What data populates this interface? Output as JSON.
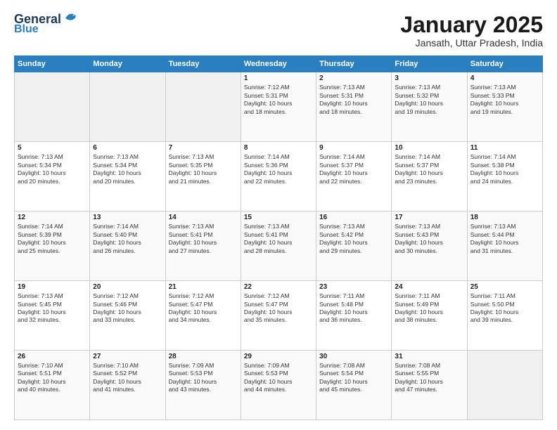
{
  "header": {
    "logo_line1": "General",
    "logo_line2": "Blue",
    "month_title": "January 2025",
    "location": "Jansath, Uttar Pradesh, India"
  },
  "weekdays": [
    "Sunday",
    "Monday",
    "Tuesday",
    "Wednesday",
    "Thursday",
    "Friday",
    "Saturday"
  ],
  "weeks": [
    [
      {
        "day": "",
        "text": ""
      },
      {
        "day": "",
        "text": ""
      },
      {
        "day": "",
        "text": ""
      },
      {
        "day": "1",
        "text": "Sunrise: 7:12 AM\nSunset: 5:31 PM\nDaylight: 10 hours\nand 18 minutes."
      },
      {
        "day": "2",
        "text": "Sunrise: 7:13 AM\nSunset: 5:31 PM\nDaylight: 10 hours\nand 18 minutes."
      },
      {
        "day": "3",
        "text": "Sunrise: 7:13 AM\nSunset: 5:32 PM\nDaylight: 10 hours\nand 19 minutes."
      },
      {
        "day": "4",
        "text": "Sunrise: 7:13 AM\nSunset: 5:33 PM\nDaylight: 10 hours\nand 19 minutes."
      }
    ],
    [
      {
        "day": "5",
        "text": "Sunrise: 7:13 AM\nSunset: 5:34 PM\nDaylight: 10 hours\nand 20 minutes."
      },
      {
        "day": "6",
        "text": "Sunrise: 7:13 AM\nSunset: 5:34 PM\nDaylight: 10 hours\nand 20 minutes."
      },
      {
        "day": "7",
        "text": "Sunrise: 7:13 AM\nSunset: 5:35 PM\nDaylight: 10 hours\nand 21 minutes."
      },
      {
        "day": "8",
        "text": "Sunrise: 7:14 AM\nSunset: 5:36 PM\nDaylight: 10 hours\nand 22 minutes."
      },
      {
        "day": "9",
        "text": "Sunrise: 7:14 AM\nSunset: 5:37 PM\nDaylight: 10 hours\nand 22 minutes."
      },
      {
        "day": "10",
        "text": "Sunrise: 7:14 AM\nSunset: 5:37 PM\nDaylight: 10 hours\nand 23 minutes."
      },
      {
        "day": "11",
        "text": "Sunrise: 7:14 AM\nSunset: 5:38 PM\nDaylight: 10 hours\nand 24 minutes."
      }
    ],
    [
      {
        "day": "12",
        "text": "Sunrise: 7:14 AM\nSunset: 5:39 PM\nDaylight: 10 hours\nand 25 minutes."
      },
      {
        "day": "13",
        "text": "Sunrise: 7:14 AM\nSunset: 5:40 PM\nDaylight: 10 hours\nand 26 minutes."
      },
      {
        "day": "14",
        "text": "Sunrise: 7:13 AM\nSunset: 5:41 PM\nDaylight: 10 hours\nand 27 minutes."
      },
      {
        "day": "15",
        "text": "Sunrise: 7:13 AM\nSunset: 5:41 PM\nDaylight: 10 hours\nand 28 minutes."
      },
      {
        "day": "16",
        "text": "Sunrise: 7:13 AM\nSunset: 5:42 PM\nDaylight: 10 hours\nand 29 minutes."
      },
      {
        "day": "17",
        "text": "Sunrise: 7:13 AM\nSunset: 5:43 PM\nDaylight: 10 hours\nand 30 minutes."
      },
      {
        "day": "18",
        "text": "Sunrise: 7:13 AM\nSunset: 5:44 PM\nDaylight: 10 hours\nand 31 minutes."
      }
    ],
    [
      {
        "day": "19",
        "text": "Sunrise: 7:13 AM\nSunset: 5:45 PM\nDaylight: 10 hours\nand 32 minutes."
      },
      {
        "day": "20",
        "text": "Sunrise: 7:12 AM\nSunset: 5:46 PM\nDaylight: 10 hours\nand 33 minutes."
      },
      {
        "day": "21",
        "text": "Sunrise: 7:12 AM\nSunset: 5:47 PM\nDaylight: 10 hours\nand 34 minutes."
      },
      {
        "day": "22",
        "text": "Sunrise: 7:12 AM\nSunset: 5:47 PM\nDaylight: 10 hours\nand 35 minutes."
      },
      {
        "day": "23",
        "text": "Sunrise: 7:11 AM\nSunset: 5:48 PM\nDaylight: 10 hours\nand 36 minutes."
      },
      {
        "day": "24",
        "text": "Sunrise: 7:11 AM\nSunset: 5:49 PM\nDaylight: 10 hours\nand 38 minutes."
      },
      {
        "day": "25",
        "text": "Sunrise: 7:11 AM\nSunset: 5:50 PM\nDaylight: 10 hours\nand 39 minutes."
      }
    ],
    [
      {
        "day": "26",
        "text": "Sunrise: 7:10 AM\nSunset: 5:51 PM\nDaylight: 10 hours\nand 40 minutes."
      },
      {
        "day": "27",
        "text": "Sunrise: 7:10 AM\nSunset: 5:52 PM\nDaylight: 10 hours\nand 41 minutes."
      },
      {
        "day": "28",
        "text": "Sunrise: 7:09 AM\nSunset: 5:53 PM\nDaylight: 10 hours\nand 43 minutes."
      },
      {
        "day": "29",
        "text": "Sunrise: 7:09 AM\nSunset: 5:53 PM\nDaylight: 10 hours\nand 44 minutes."
      },
      {
        "day": "30",
        "text": "Sunrise: 7:08 AM\nSunset: 5:54 PM\nDaylight: 10 hours\nand 45 minutes."
      },
      {
        "day": "31",
        "text": "Sunrise: 7:08 AM\nSunset: 5:55 PM\nDaylight: 10 hours\nand 47 minutes."
      },
      {
        "day": "",
        "text": ""
      }
    ]
  ]
}
